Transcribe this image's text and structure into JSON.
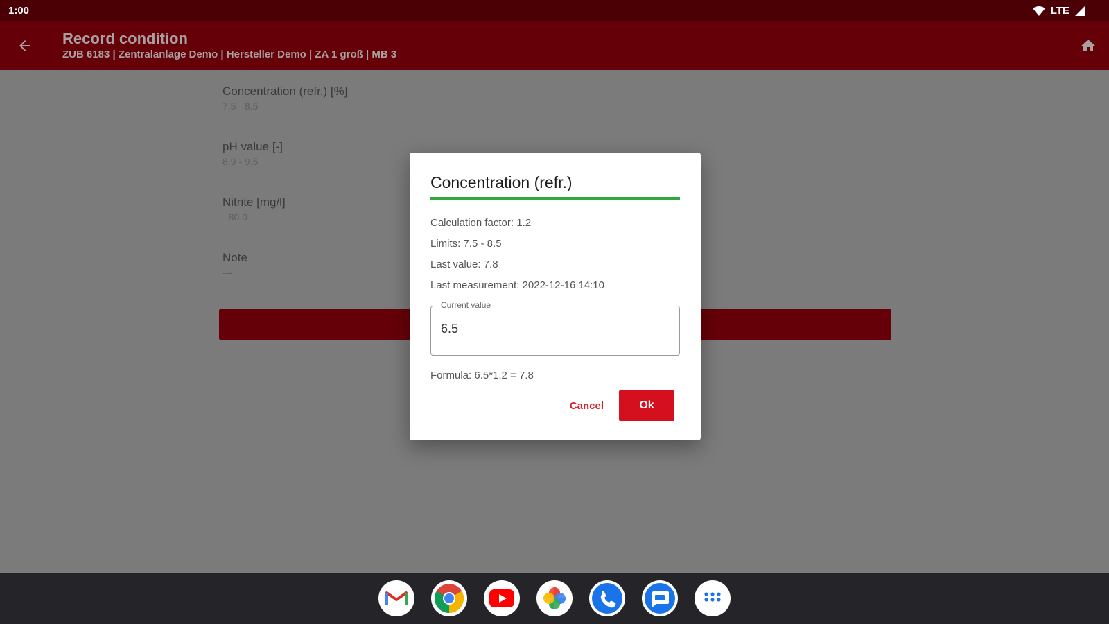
{
  "status_bar": {
    "time": "1:00",
    "network": "LTE"
  },
  "app_bar": {
    "title": "Record condition",
    "subtitle": "ZUB 6183 | Zentralanlage Demo | Hersteller Demo | ZA 1 groß | MB 3"
  },
  "form": {
    "fields": [
      {
        "label": "Concentration (refr.) [%]",
        "range": "7.5 - 8.5"
      },
      {
        "label": "pH value [-]",
        "range": "8.9 - 9.5"
      },
      {
        "label": "Nitrite [mg/l]",
        "range": "- 80.0"
      },
      {
        "label": "Note",
        "range": "---"
      }
    ]
  },
  "dialog": {
    "title": "Concentration (refr.)",
    "calculation_factor": "Calculation factor: 1.2",
    "limits": "Limits: 7.5 - 8.5",
    "last_value": "Last value: 7.8",
    "last_measurement": "Last measurement: 2022-12-16 14:10",
    "current_value_label": "Current value",
    "current_value": "6.5",
    "formula": "Formula: 6.5*1.2 = 7.8",
    "cancel_label": "Cancel",
    "ok_label": "Ok"
  },
  "colors": {
    "app_bar": "#660008",
    "status_bar": "#4a0005",
    "accent": "#d4101f",
    "success_line": "#2fa83f"
  },
  "taskbar": {
    "apps": [
      "gmail-icon",
      "chrome-icon",
      "youtube-icon",
      "photos-icon",
      "phone-icon",
      "messages-icon",
      "app-drawer-icon"
    ]
  }
}
